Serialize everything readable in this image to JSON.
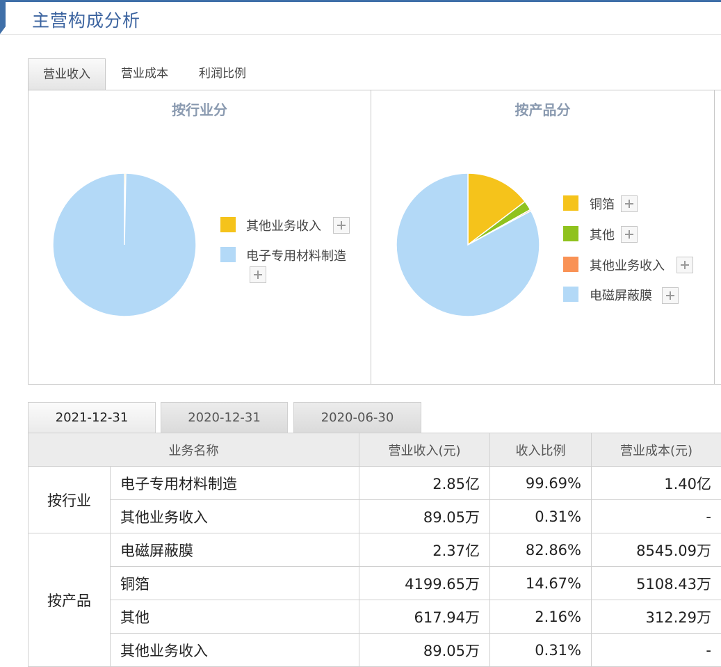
{
  "page": {
    "title": "主营构成分析"
  },
  "tabs": [
    {
      "label": "营业收入",
      "active": true
    },
    {
      "label": "营业成本",
      "active": false
    },
    {
      "label": "利润比例",
      "active": false
    }
  ],
  "chart_data": [
    {
      "type": "pie",
      "title": "按行业分",
      "categories": [
        "其他业务收入",
        "电子专用材料制造"
      ],
      "values": [
        0.31,
        99.69
      ],
      "colors": [
        "#f5c31b",
        "#b3d9f7"
      ]
    },
    {
      "type": "pie",
      "title": "按产品分",
      "categories": [
        "铜箔",
        "其他",
        "其他业务收入",
        "电磁屏蔽膜"
      ],
      "values": [
        14.67,
        2.16,
        0.31,
        82.86
      ],
      "colors": [
        "#f5c31b",
        "#8fc21e",
        "#f99255",
        "#b3d9f7"
      ]
    }
  ],
  "date_tabs": [
    {
      "label": "2021-12-31",
      "active": true
    },
    {
      "label": "2020-12-31",
      "active": false
    },
    {
      "label": "2020-06-30",
      "active": false
    }
  ],
  "table": {
    "headers": [
      "业务名称",
      "营业收入(元)",
      "收入比例",
      "营业成本(元)"
    ],
    "groups": [
      {
        "label": "按行业",
        "rows": [
          {
            "name": "电子专用材料制造",
            "revenue": "2.85亿",
            "ratio": "99.69%",
            "cost": "1.40亿"
          },
          {
            "name": "其他业务收入",
            "revenue": "89.05万",
            "ratio": "0.31%",
            "cost": "-"
          }
        ]
      },
      {
        "label": "按产品",
        "rows": [
          {
            "name": "电磁屏蔽膜",
            "revenue": "2.37亿",
            "ratio": "82.86%",
            "cost": "8545.09万"
          },
          {
            "name": "铜箔",
            "revenue": "4199.65万",
            "ratio": "14.67%",
            "cost": "5108.43万"
          },
          {
            "name": "其他",
            "revenue": "617.94万",
            "ratio": "2.16%",
            "cost": "312.29万"
          },
          {
            "name": "其他业务收入",
            "revenue": "89.05万",
            "ratio": "0.31%",
            "cost": "-"
          }
        ]
      }
    ]
  }
}
